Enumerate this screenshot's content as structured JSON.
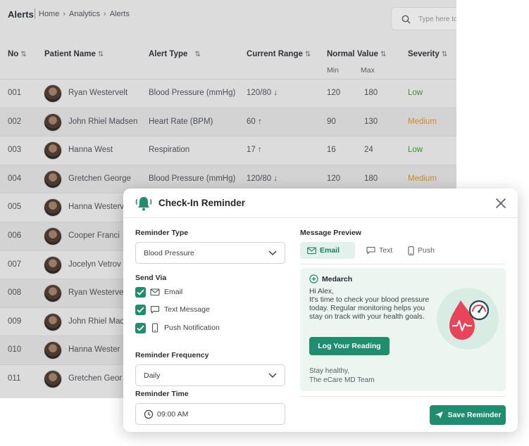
{
  "breadcrumb": {
    "title": "Alerts",
    "items": [
      "Home",
      "Analytics",
      "Alerts"
    ]
  },
  "search": {
    "placeholder": "Type here to search"
  },
  "table": {
    "columns": {
      "no": "No",
      "patient": "Patient Name",
      "alert_type": "Alert Type",
      "current_range": "Current Range",
      "normal_value": "Normal Value",
      "normal_min": "Min",
      "normal_max": "Max",
      "severity": "Severity"
    },
    "rows": [
      {
        "no": "001",
        "name": "Ryan Westervelt",
        "alert_type": "Blood Pressure (mmHg)",
        "range": "120/80 ↓",
        "min": "120",
        "max": "180",
        "severity": "Low"
      },
      {
        "no": "002",
        "name": "John Rhiel Madsen",
        "alert_type": "Heart Rate (BPM)",
        "range": "60 ↑",
        "min": "90",
        "max": "130",
        "severity": "Medium"
      },
      {
        "no": "003",
        "name": "Hanna West",
        "alert_type": "Respiration",
        "range": "17 ↑",
        "min": "16",
        "max": "24",
        "severity": "Low"
      },
      {
        "no": "004",
        "name": "Gretchen George",
        "alert_type": "Blood Pressure (mmHg)",
        "range": "120/80 ↓",
        "min": "120",
        "max": "180",
        "severity": "Medium"
      },
      {
        "no": "005",
        "name": "Hanna Westerv"
      },
      {
        "no": "006",
        "name": "Cooper Franci"
      },
      {
        "no": "007",
        "name": "Jocelyn Vetrov"
      },
      {
        "no": "008",
        "name": "Ryan Westerve"
      },
      {
        "no": "009",
        "name": "John Rhiel Mad"
      },
      {
        "no": "010",
        "name": "Hanna Wester"
      },
      {
        "no": "011",
        "name": "Gretchen Geor"
      }
    ]
  },
  "modal": {
    "title": "Check-In Reminder",
    "reminder_type_label": "Reminder Type",
    "reminder_type_value": "Blood Pressure",
    "send_via_label": "Send Via",
    "send_via": [
      "Email",
      "Text Message",
      "Push Notification"
    ],
    "frequency_label": "Reminder Frequency",
    "frequency_value": "Daily",
    "time_label": "Reminder Time",
    "time_value": "09:00 AM",
    "preview_label": "Message Preview",
    "tabs": [
      "Email",
      "Text",
      "Push"
    ],
    "brand": "Medarch",
    "greeting": "Hi Alex,",
    "message_lines": [
      "It's time to check your blood pressure",
      "today. Regular monitoring helps you",
      "stay on track with your health goals."
    ],
    "cta": "Log Your Reading",
    "signoff_1": "Stay healthy,",
    "signoff_2": "The eCare MD Team",
    "save_button": "Save Reminder"
  },
  "colors": {
    "accent": "#1e8e6e",
    "low": "#3e8f2c",
    "medium": "#d08a25",
    "overlay_bg": "#dcdcdc"
  }
}
